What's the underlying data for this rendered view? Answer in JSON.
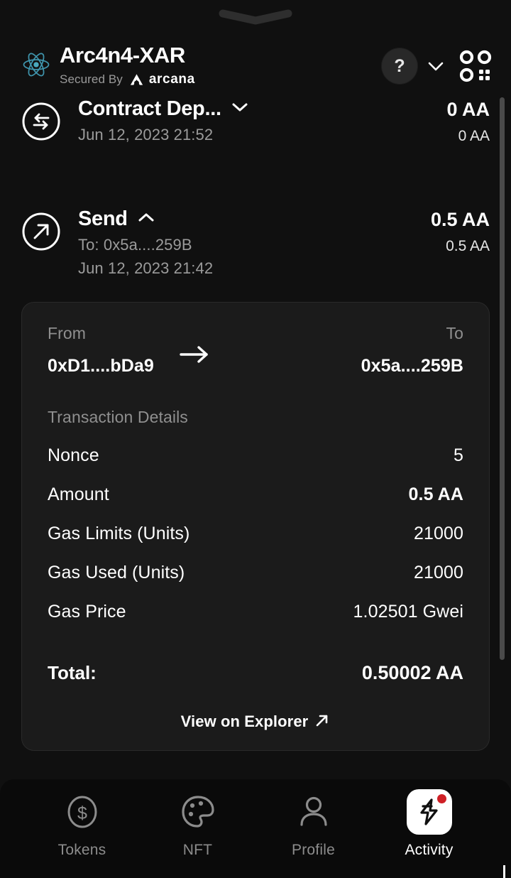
{
  "window": {
    "background_color": "#101010",
    "drag_handle_icon": "chevron-handle-icon"
  },
  "header": {
    "logo_icon": "react-logo-icon",
    "title": "Arc4n4-XAR",
    "secured_by_label": "Secured By",
    "provider_name": "arcana",
    "provider_logo_icon": "arcana-logo-icon",
    "avatar_icon": "question-mark-avatar-icon",
    "chevron_icon": "chevron-down-icon",
    "qr_icon": "qr-scan-icon"
  },
  "transactions": [
    {
      "icon": "swap-arrows-circle-icon",
      "title": "Contract Dep...",
      "expand_icon": "chevron-down-icon",
      "subtitle": "Jun 12, 2023 21:52",
      "amount": "0 AA",
      "fiat": "0 AA",
      "expanded": false
    },
    {
      "icon": "arrow-up-right-circle-icon",
      "title": "Send",
      "expand_icon": "chevron-up-icon",
      "recipient": "To: 0x5a....259B",
      "subtitle": "Jun 12, 2023 21:42",
      "amount": "0.5 AA",
      "fiat": "0.5 AA",
      "expanded": true
    }
  ],
  "details_card": {
    "from_label": "From",
    "from_value": "0xD1....bDa9",
    "arrow_icon": "arrow-right-icon",
    "to_label": "To",
    "to_value": "0x5a....259B",
    "section_label": "Transaction Details",
    "rows": [
      {
        "key": "Nonce",
        "value": "5",
        "bold": false
      },
      {
        "key": "Amount",
        "value": "0.5 AA",
        "bold": true
      },
      {
        "key": "Gas Limits (Units)",
        "value": "21000",
        "bold": false
      },
      {
        "key": "Gas Used (Units)",
        "value": "21000",
        "bold": false
      },
      {
        "key": "Gas Price",
        "value": "1.02501 Gwei",
        "bold": false
      }
    ],
    "total_label": "Total:",
    "total_value": "0.50002 AA",
    "explorer_label": "View on Explorer",
    "explorer_icon": "external-link-arrow-icon"
  },
  "bottom_nav": {
    "items": [
      {
        "label": "Tokens",
        "icon": "dollar-circle-icon",
        "active": false
      },
      {
        "label": "NFT",
        "icon": "palette-icon",
        "active": false
      },
      {
        "label": "Profile",
        "icon": "person-icon",
        "active": false
      },
      {
        "label": "Activity",
        "icon": "lightning-bolt-icon",
        "active": true,
        "badge": true
      }
    ],
    "active_tile_color": "#ffffff",
    "badge_color": "#cf2026"
  },
  "scrollbar": {
    "visible": true,
    "color": "#4a4a4a"
  }
}
